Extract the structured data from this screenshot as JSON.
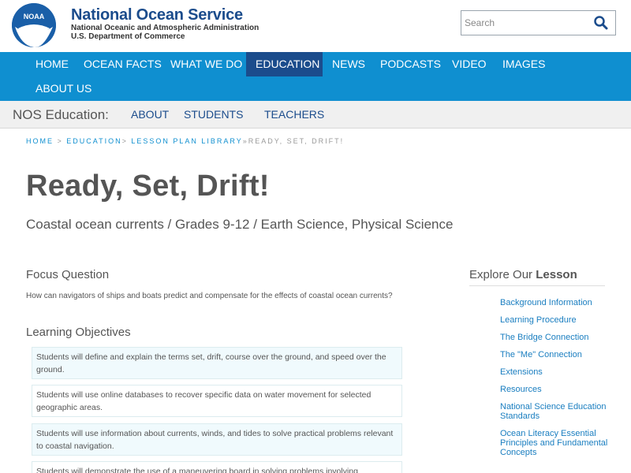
{
  "header": {
    "logo_text": "NOAA",
    "title": "National Ocean Service",
    "subtitle_line1": "National Oceanic and Atmospheric Administration",
    "subtitle_line2": "U.S. Department of Commerce",
    "search_placeholder": "Search",
    "search_icon": "search-icon"
  },
  "primary_nav": {
    "items": [
      {
        "label": "HOME"
      },
      {
        "label": "OCEAN FACTS"
      },
      {
        "label": "WHAT WE DO"
      },
      {
        "label": "EDUCATION",
        "active": true
      },
      {
        "label": "NEWS"
      },
      {
        "label": "PODCASTS"
      },
      {
        "label": "VIDEO"
      },
      {
        "label": "IMAGES"
      },
      {
        "label": "ABOUT US"
      }
    ]
  },
  "secondary_nav": {
    "title": "NOS Education:",
    "items": [
      {
        "label": "ABOUT"
      },
      {
        "label": "STUDENTS"
      },
      {
        "label": "TEACHERS"
      }
    ]
  },
  "breadcrumb": {
    "items": [
      "HOME",
      "EDUCATION",
      "LESSON PLAN LIBRARY"
    ],
    "separators": [
      " > ",
      "> ",
      "»"
    ],
    "current": "READY, SET, DRIFT!"
  },
  "page": {
    "title": "Ready, Set, Drift!",
    "subtitle": "Coastal ocean currents / Grades 9-12 / Earth Science, Physical Science"
  },
  "main": {
    "focus_heading": "Focus Question",
    "focus_text": "How can navigators of ships and boats predict and compensate for the effects of coastal ocean currents?",
    "objectives_heading": "Learning Objectives",
    "objectives": [
      "Students will define and explain the terms set, drift, course over the ground, and speed over the ground.",
      "Students will use online databases to recover specific data on water movement for selected geographic areas.",
      "Students will use information about currents, winds, and tides to solve practical problems relevant to coastal navigation.",
      "Students will demonstrate the use of a maneuvering board in solving problems involving"
    ]
  },
  "sidebar": {
    "heading_prefix": "Explore Our",
    "heading_bold": "Lesson",
    "items": [
      "Background Information",
      "Learning Procedure",
      "The Bridge Connection",
      "The \"Me\" Connection",
      "Extensions",
      "Resources",
      "National Science Education Standards",
      "Ocean Literacy Essential Principles and Fundamental Concepts"
    ]
  },
  "colors": {
    "brand_blue": "#1b4c8c",
    "nav_blue": "#0f8fd0",
    "link_blue": "#1a7ec0"
  }
}
